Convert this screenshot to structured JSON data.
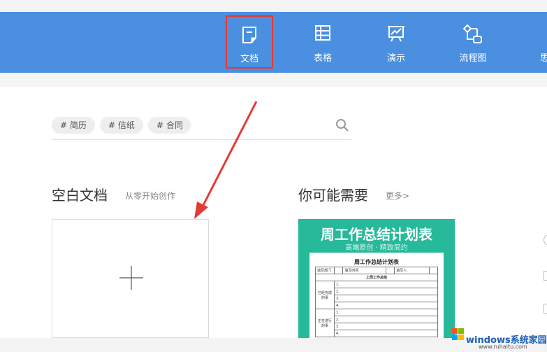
{
  "nav": {
    "items": [
      {
        "label": "文档",
        "icon": "document-icon",
        "active": true
      },
      {
        "label": "表格",
        "icon": "spreadsheet-icon",
        "active": false
      },
      {
        "label": "演示",
        "icon": "presentation-icon",
        "active": false
      },
      {
        "label": "流程图",
        "icon": "flowchart-icon",
        "active": false
      },
      {
        "label": "思",
        "icon": "mindmap-icon",
        "active": false
      }
    ]
  },
  "search": {
    "tags": [
      "# 简历",
      "# 信纸",
      "# 合同"
    ],
    "icon": "search-icon"
  },
  "blank_section": {
    "title": "空白文档",
    "subtitle": "从零开始创作"
  },
  "suggest_section": {
    "title": "你可能需要",
    "more_label": "更多>"
  },
  "template_card": {
    "title": "周工作总结计划表",
    "subtitle": "高端原创 · 精致简约",
    "paper_title": "周工作总结计划表",
    "row_labels": [
      "填写部门",
      "填写时间",
      "填写人"
    ],
    "section_heading": "上周工作总结",
    "left_label_1": "已经完成的事",
    "left_label_2": "正在进行的事",
    "numbers": [
      "1.",
      "2.",
      "3.",
      "4."
    ]
  },
  "watermark": {
    "text": "windows系统家园",
    "url": "www.ruhaitu.com"
  },
  "colors": {
    "topbar": "#4a8fe0",
    "active_border": "#e53935",
    "template_bg": "#26b99a",
    "arrow": "#e53935"
  }
}
